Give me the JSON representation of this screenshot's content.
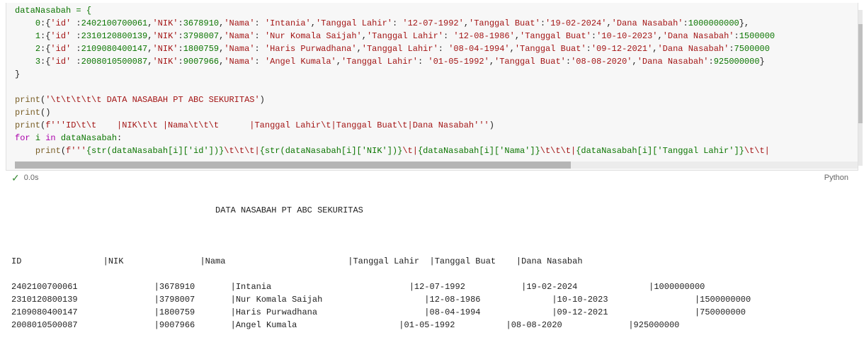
{
  "editor": {
    "var_decl": "dataNasabah = {",
    "close_brace": "}",
    "records": [
      {
        "idx": "0",
        "id": "2402100700061",
        "nik": "3678910",
        "nama": "Intania",
        "tgl_lahir": "12-07-1992",
        "tgl_buat": "19-02-2024",
        "dana": "1000000000",
        "closer": "},"
      },
      {
        "idx": "1",
        "id": "2310120800139",
        "nik": "3798007",
        "nama": "Nur Komala Saijah",
        "tgl_lahir": "12-08-1986",
        "tgl_buat": "10-10-2023",
        "dana": "1500000",
        "closer": ""
      },
      {
        "idx": "2",
        "id": "2109080400147",
        "nik": "1800759",
        "nama": "Haris Purwadhana",
        "tgl_lahir": "08-04-1994",
        "tgl_buat": "09-12-2021",
        "dana": "7500000",
        "closer": ""
      },
      {
        "idx": "3",
        "id": "2008010500087",
        "nik": "9007966",
        "nama": "Angel Kumala",
        "tgl_lahir": "01-05-1992",
        "tgl_buat": "08-08-2020",
        "dana": "925000000",
        "closer": "}"
      }
    ],
    "print_title": "print('\\t\\t\\t\\t\\t DATA NASABAH PT ABC SEKURITAS')",
    "print_empty": "print()",
    "print_header": "print(f'''ID\\t\\t    |NIK\\t\\t |Nama\\t\\t\\t      |Tanggal Lahir\\t|Tanggal Buat\\t|Dana Nasabah''')",
    "for_line": "for i in dataNasabah:",
    "print_row_prefix": "    print(f'''",
    "print_row_parts": {
      "p1": "{str(dataNasabah[i]['id'])}",
      "s1": "\\t\\t\\t|",
      "p2": "{str(dataNasabah[i]['NIK'])}",
      "s2": "\\t|",
      "p3": "{dataNasabah[i]['Nama']}",
      "s3": "\\t\\t\\t|",
      "p4": "{dataNasabah[i]['Tanggal Lahir']}",
      "s4": "\\t\\t|"
    }
  },
  "status": {
    "check": "✓",
    "time": "0.0s",
    "lang": "Python"
  },
  "output": {
    "title_indent": "                                        ",
    "title": "DATA NASABAH PT ABC SEKURITAS",
    "header": "ID                |NIK               |Nama                        |Tanggal Lahir  |Tanggal Buat    |Dana Nasabah",
    "rows": [
      "2402100700061               |3678910       |Intania                           |12-07-1992           |19-02-2024              |1000000000",
      "2310120800139               |3798007       |Nur Komala Saijah                    |12-08-1986              |10-10-2023                 |1500000000",
      "2109080400147               |1800759       |Haris Purwadhana                     |08-04-1994              |09-12-2021                 |750000000",
      "2008010500087               |9007966       |Angel Kumala                    |01-05-1992          |08-08-2020             |925000000"
    ]
  }
}
